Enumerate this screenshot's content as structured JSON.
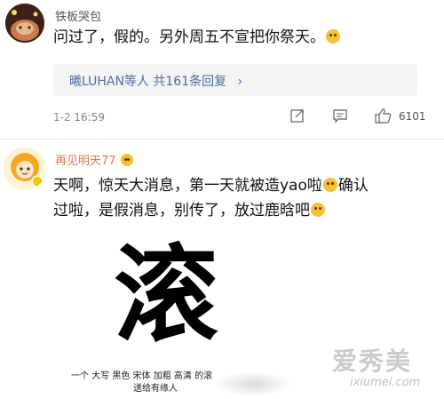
{
  "comments": [
    {
      "user": "铁板哭包",
      "text": "问过了，假的。另外周五不宣把你祭天。",
      "reply_prefix": "曦LUHAN等人",
      "reply_count_text": "共161条回复",
      "reply_chevron": "›",
      "time": "1-2 16:59",
      "likes": "6101",
      "icons": [
        "share-icon",
        "comment-icon",
        "like-icon"
      ]
    },
    {
      "user": "再见明天77",
      "text_line1": "天啊，惊天大消息，第一天就被造yao啦",
      "text_line1_tail": "确认",
      "text_line2": "过啦，是假消息，别传了，放过鹿晗吧",
      "image": {
        "character": "滚",
        "caption_line1": "一个 大写 黑色 宋体 加粗 高清 的滚",
        "caption_line2": "送给有缘人"
      }
    }
  ],
  "watermark": {
    "brand": "爱秀美",
    "url": "ixiumei.com"
  },
  "colors": {
    "name_gray": "#555555",
    "name_orange": "#eb7350",
    "link_blue": "#4a6da7",
    "reply_bg": "#f4f4f4"
  }
}
